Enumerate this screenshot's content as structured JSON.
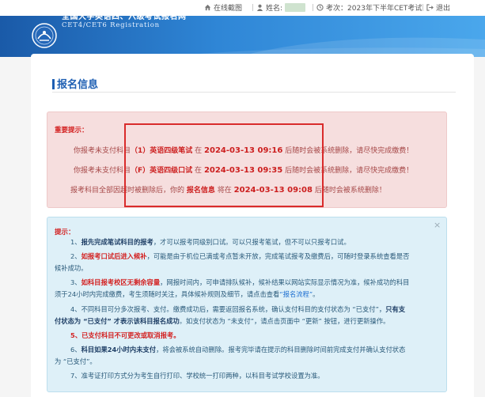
{
  "topbar": {
    "home": "在线截图",
    "name_label": "姓名:",
    "exam": "考次：2023年下半年CET考试",
    "logout": "退出"
  },
  "header": {
    "site_cn": "全国大学英语四、六级考试报名网",
    "site_en": "CET4/CET6 Registration"
  },
  "page": {
    "title": "报名信息"
  },
  "alert": {
    "heading": "重要提示：",
    "line1": {
      "pre": "你报考未支付科目",
      "subject": "（1）英语四级笔试",
      "mid": "在",
      "date": "2024-03-13 09:16",
      "post": "后随时会被系统删除，请尽快完成缴费！"
    },
    "line2": {
      "pre": "你报考未支付科目",
      "subject": "（F）英语四级口试",
      "mid": "在",
      "date": "2024-03-13 09:35",
      "post": "后随时会被系统删除，请尽快完成缴费！"
    },
    "line3": {
      "pre": "报考科目全部因超时被删除后，你的",
      "subject": "报名信息",
      "mid": "将在",
      "date": "2024-03-13 09:08",
      "post": "后随时会被系统删除！"
    }
  },
  "tips": {
    "close": "×",
    "heading": "提示：",
    "t1a": "1、",
    "t1b": "报先完成笔试科目的报考",
    "t1c": "，才可以报考同级别口试。可以只报考笔试，但不可以只报考口试。",
    "t2a": "2、",
    "t2b": "如报考口试后进入候补",
    "t2c": "，可能是由于机位已满或考点暂未开放，完成笔试报考及缴费后，可随时登录系统查看是否",
    "t2d": "候补成功。",
    "t3a": "3、",
    "t3b": "如科目报考校区无剩余容量",
    "t3c": "，网报时间内，可申请排队候补，候补结果以网站实际显示情况为准，候补成功的科目",
    "t3d": "须于24小时内完成缴费，考生须随时关注，具体候补规则及细节，请点击查看",
    "t3e": "“报名流程”",
    "t3f": "。",
    "t4a": "4、不同科目可分多次报考、支付。缴费成功后，需要返回报名系统，确认支付科目的支付状态为 “已支付”，",
    "t4b": "只有支",
    "t4c": "付状态为 “已支付” 才表示该科目报名成功",
    "t4d": "。如支付状态为 “未支付”，请点击页面中 “更新” 按钮，进行更新操作。",
    "t5": "5、已支付科目不可更改或取消报考。",
    "t6a": "6、",
    "t6b": "科目如果24小时内未支付",
    "t6c": "，将会被系统自动删除。报考完毕请在提示的科目删除时间前完成支付并确认支付状态",
    "t6d": "为 “已支付”。",
    "t7": "7、准考证打印方式分为考生自行打印、学校统一打印两种，以科目考试学校设置为准。"
  },
  "colors": {
    "header_blue": "#1a5aa8",
    "title_blue": "#1e5fb3",
    "alert_red": "#cc1f1f",
    "alert_bg": "#f6dede",
    "tips_bg": "#def0f8"
  }
}
